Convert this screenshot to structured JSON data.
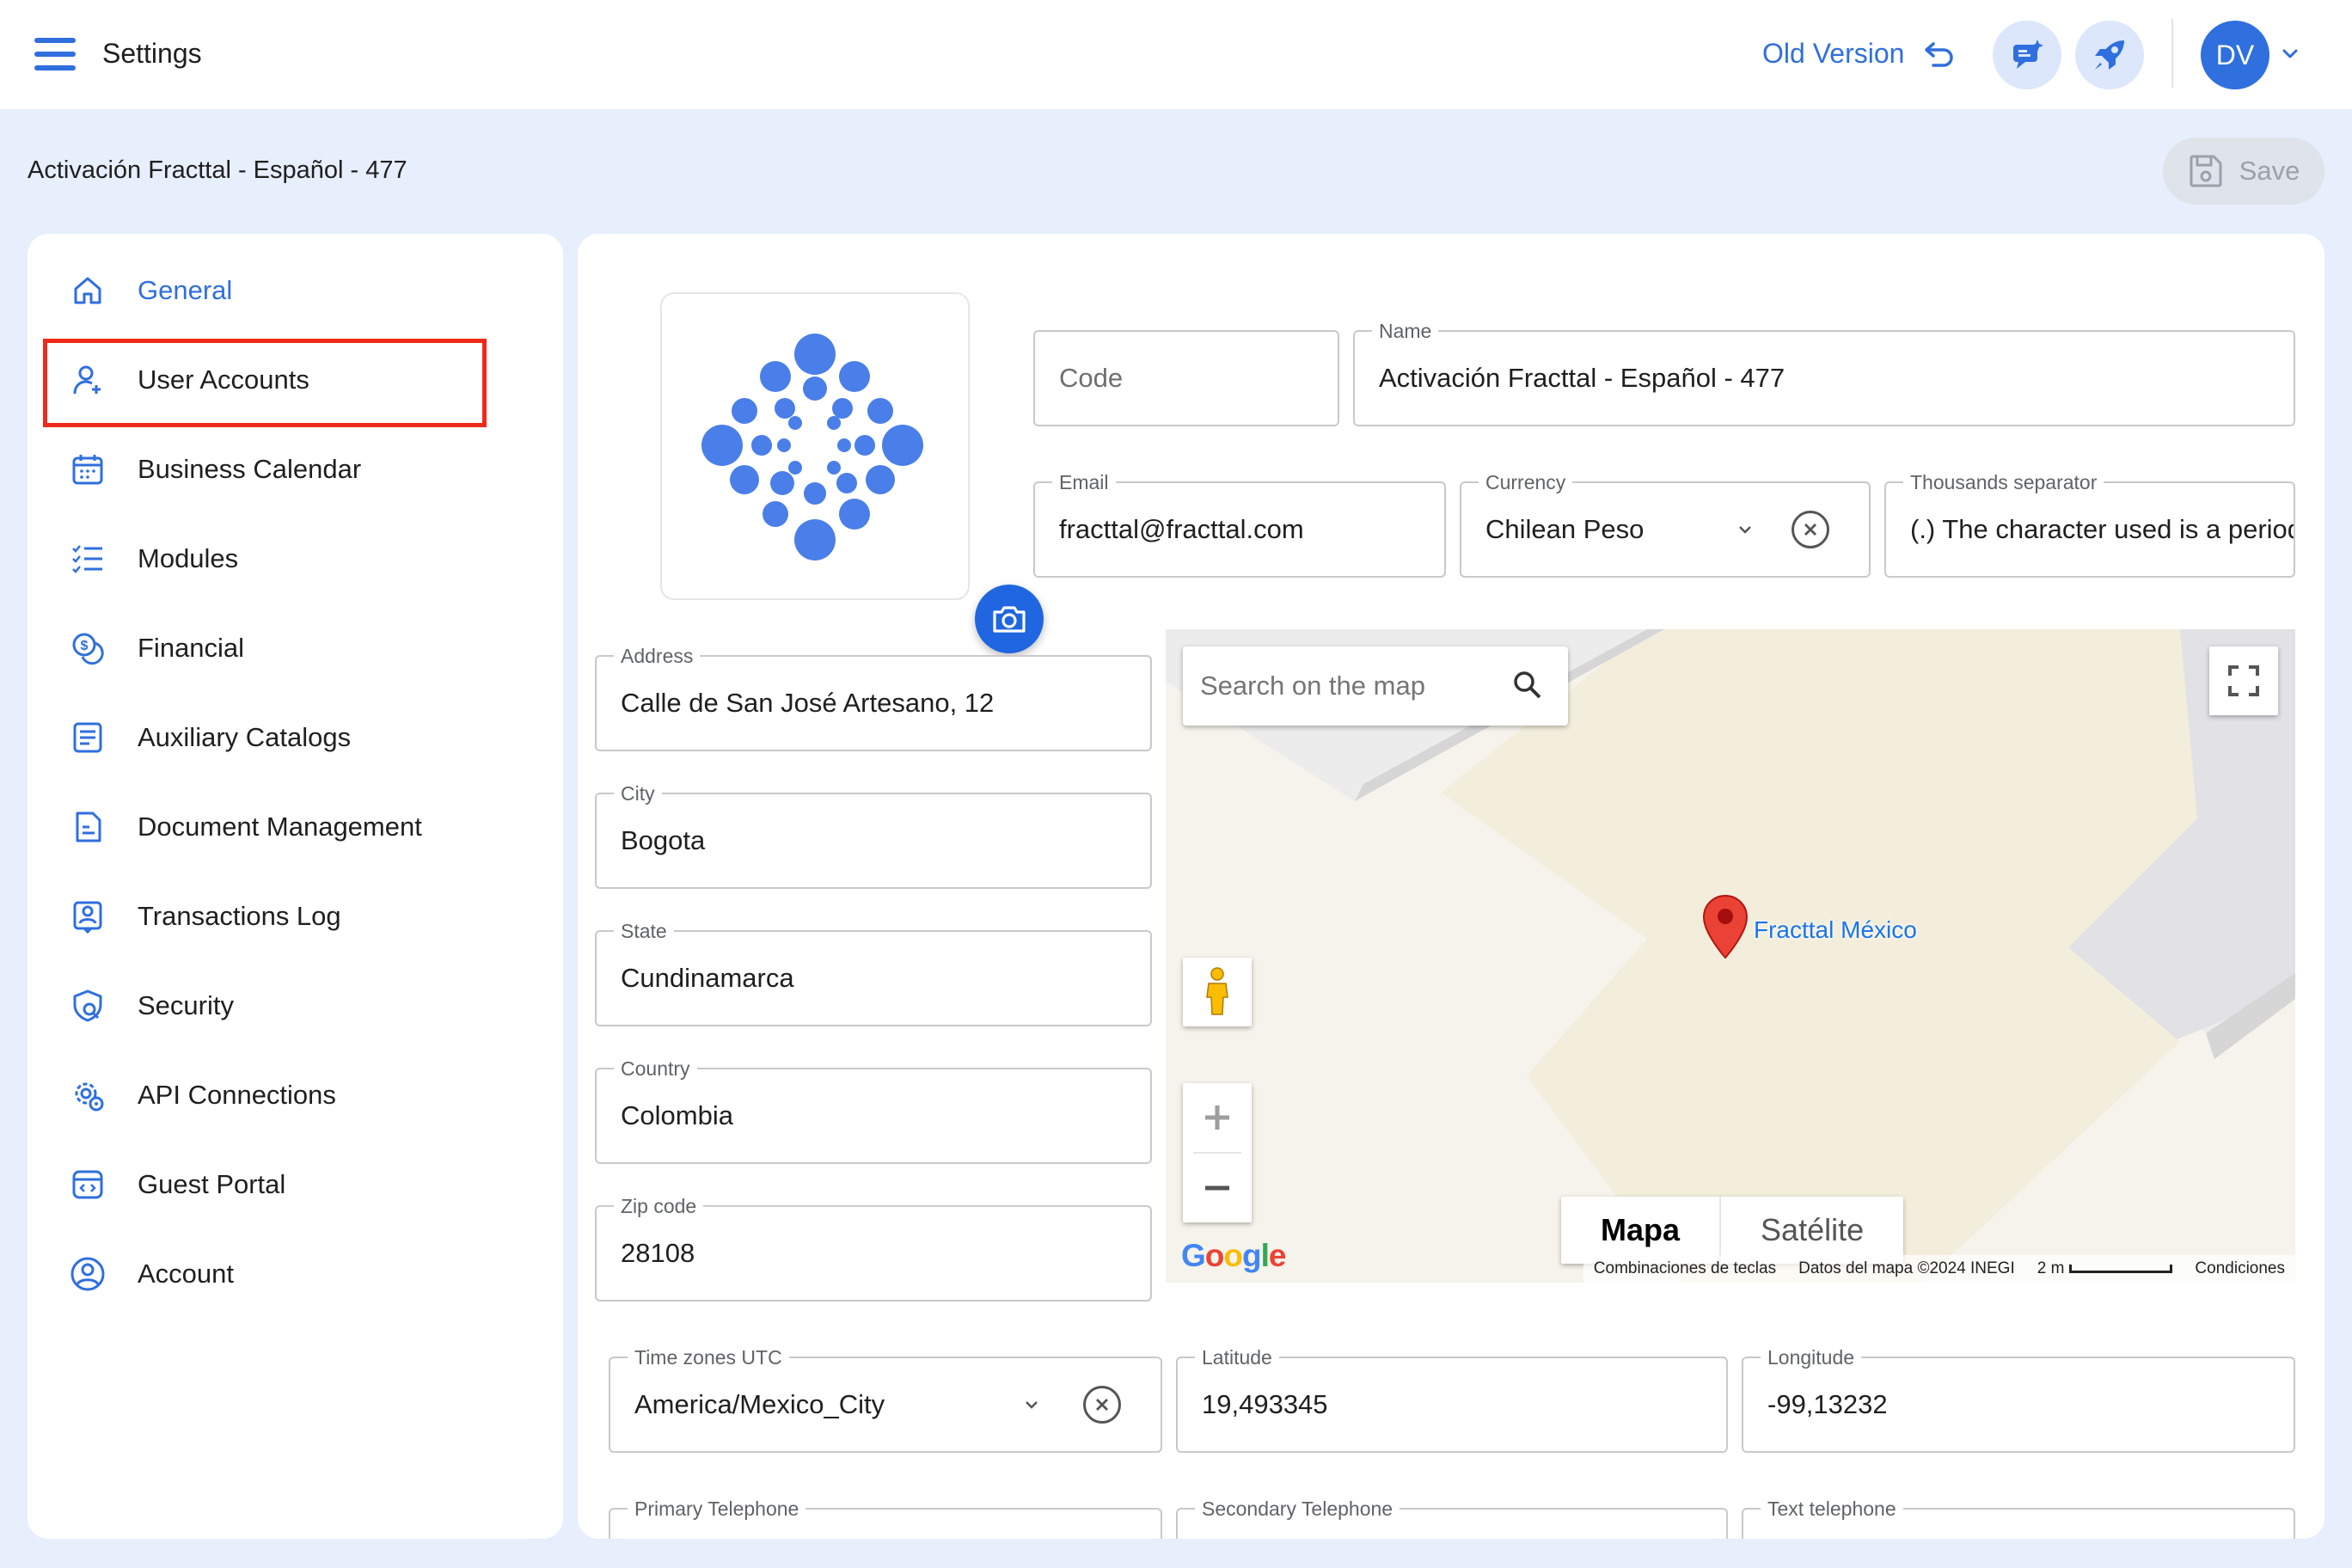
{
  "header": {
    "app_title": "Settings",
    "old_version_label": "Old Version",
    "avatar_initials": "DV"
  },
  "subheader": {
    "company_title": "Activación Fracttal - Español - 477",
    "save_label": "Save"
  },
  "sidebar": {
    "items": [
      {
        "label": "General",
        "icon": "home-icon"
      },
      {
        "label": "User Accounts",
        "icon": "user-add-icon"
      },
      {
        "label": "Business Calendar",
        "icon": "calendar-icon"
      },
      {
        "label": "Modules",
        "icon": "checklist-icon"
      },
      {
        "label": "Financial",
        "icon": "money-icon"
      },
      {
        "label": "Auxiliary Catalogs",
        "icon": "catalog-icon"
      },
      {
        "label": "Document Management",
        "icon": "document-icon"
      },
      {
        "label": "Transactions Log",
        "icon": "log-icon"
      },
      {
        "label": "Security",
        "icon": "shield-search-icon"
      },
      {
        "label": "API Connections",
        "icon": "api-gear-icon"
      },
      {
        "label": "Guest Portal",
        "icon": "portal-icon"
      },
      {
        "label": "Account",
        "icon": "account-circle-icon"
      }
    ]
  },
  "form": {
    "code": {
      "placeholder": "Code"
    },
    "name": {
      "label": "Name",
      "value": "Activación Fracttal - Español - 477"
    },
    "email": {
      "label": "Email",
      "value": "fracttal@fracttal.com"
    },
    "currency": {
      "label": "Currency",
      "value": "Chilean Peso"
    },
    "thousands": {
      "label": "Thousands separator",
      "value": "(.) The character used is a period"
    },
    "address": {
      "label": "Address",
      "value": "Calle de San José Artesano, 12"
    },
    "city": {
      "label": "City",
      "value": "Bogota"
    },
    "state": {
      "label": "State",
      "value": "Cundinamarca"
    },
    "country": {
      "label": "Country",
      "value": "Colombia"
    },
    "zip": {
      "label": "Zip code",
      "value": "28108"
    },
    "timezone": {
      "label": "Time zones UTC",
      "value": "America/Mexico_City"
    },
    "latitude": {
      "label": "Latitude",
      "value": "19,493345"
    },
    "longitude": {
      "label": "Longitude",
      "value": "-99,13232"
    },
    "primary_phone": {
      "label": "Primary Telephone"
    },
    "secondary_phone": {
      "label": "Secondary Telephone"
    },
    "text_phone": {
      "label": "Text telephone"
    }
  },
  "map": {
    "search_placeholder": "Search on the map",
    "place_label": "Fracttal México",
    "type_map": "Mapa",
    "type_satellite": "Satélite",
    "footer": {
      "shortcuts": "Combinaciones de teclas",
      "data": "Datos del mapa ©2024 INEGI",
      "scale": "2 m",
      "terms": "Condiciones"
    }
  },
  "colors": {
    "accent": "#2f6fde",
    "highlight": "#ee2a1b",
    "background": "#e7eefc"
  }
}
